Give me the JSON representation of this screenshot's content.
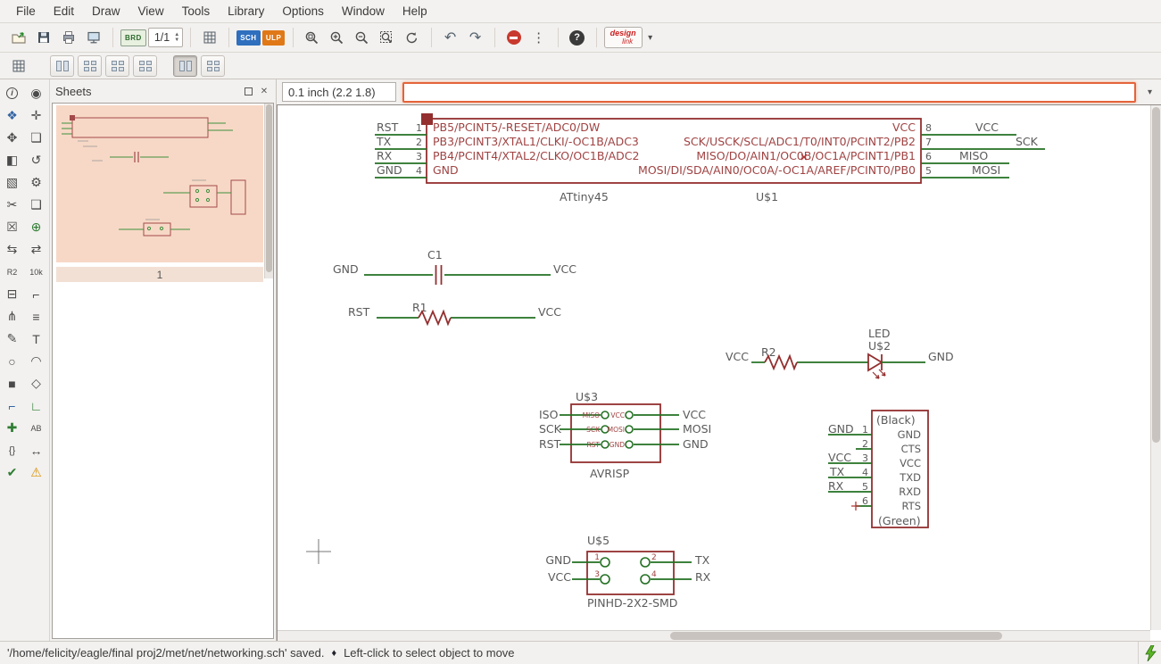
{
  "menubar": {
    "items": [
      "File",
      "Edit",
      "Draw",
      "View",
      "Tools",
      "Library",
      "Options",
      "Window",
      "Help"
    ]
  },
  "toolbar": {
    "sheet_indicator": "1/1",
    "brd_label": "BRD",
    "sch_label": "SCH",
    "ulp_label": "ULP",
    "help_label": "?",
    "design_link_label_1": "design",
    "design_link_label_2": "link",
    "dropdown_caret": "▾",
    "undo_glyph": "↶",
    "redo_glyph": "↷",
    "dots_glyph": "⋮"
  },
  "display_toolbar": {
    "presets": [
      {
        "name": "display-preset-1",
        "pattern": 2,
        "pressed": false,
        "gap": false
      },
      {
        "name": "display-preset-2",
        "pattern": 4,
        "pressed": false,
        "gap": false
      },
      {
        "name": "display-preset-3",
        "pattern": 4,
        "pressed": false,
        "gap": false
      },
      {
        "name": "display-preset-4",
        "pattern": 4,
        "pressed": false,
        "gap": false
      },
      {
        "name": "display-preset-5",
        "pattern": 2,
        "pressed": true,
        "gap": true
      },
      {
        "name": "display-preset-6",
        "pattern": 4,
        "pressed": false,
        "gap": false
      }
    ]
  },
  "command_bar": {
    "coordinates": "0.1 inch (2.2 1.8)",
    "command_value": ""
  },
  "sheets_panel": {
    "title": "Sheets",
    "sheet_label": "1",
    "close_glyph": "✕"
  },
  "left_toolbar": {
    "tools": [
      {
        "name": "info-button",
        "glyph": "i",
        "circle": true
      },
      {
        "name": "show-button",
        "glyph": "◉"
      },
      {
        "name": "display-button",
        "glyph": "❖",
        "color": "#3465a4"
      },
      {
        "name": "mark-button",
        "glyph": "✛"
      },
      {
        "name": "move-button",
        "glyph": "✥"
      },
      {
        "name": "copy-button",
        "glyph": "❏"
      },
      {
        "name": "mirror-button",
        "glyph": "◧"
      },
      {
        "name": "rotate-button",
        "glyph": "↺"
      },
      {
        "name": "group-button",
        "glyph": "▧"
      },
      {
        "name": "change-button",
        "glyph": "⚙"
      },
      {
        "name": "cut-button",
        "glyph": "✂"
      },
      {
        "name": "paste-button",
        "glyph": "❑"
      },
      {
        "name": "delete-button",
        "glyph": "☒"
      },
      {
        "name": "add-button",
        "glyph": "⊕",
        "color": "#2e7d32"
      },
      {
        "name": "pinswap-button",
        "glyph": "⇆"
      },
      {
        "name": "replace-button",
        "glyph": "⇄"
      },
      {
        "name": "name-button",
        "glyph": "R2",
        "size": 9
      },
      {
        "name": "value-button",
        "glyph": "10k",
        "size": 9
      },
      {
        "name": "smash-button",
        "glyph": "⊟"
      },
      {
        "name": "miter-button",
        "glyph": "⌐"
      },
      {
        "name": "split-button",
        "glyph": "⋔"
      },
      {
        "name": "invoke-button",
        "glyph": "≡"
      },
      {
        "name": "wire-button",
        "glyph": "✎"
      },
      {
        "name": "text-button",
        "glyph": "T"
      },
      {
        "name": "circle-button",
        "glyph": "○"
      },
      {
        "name": "arc-button",
        "glyph": "◠"
      },
      {
        "name": "rect-button",
        "glyph": "■"
      },
      {
        "name": "polygon-button",
        "glyph": "◇"
      },
      {
        "name": "bus-button",
        "glyph": "⌐",
        "color": "#3465a4"
      },
      {
        "name": "net-button",
        "glyph": "∟",
        "color": "#2e7d32"
      },
      {
        "name": "junction-button",
        "glyph": "✚",
        "color": "#2e7d32"
      },
      {
        "name": "label-button",
        "glyph": "AB",
        "size": 9
      },
      {
        "name": "attribute-button",
        "glyph": "{}",
        "size": 11
      },
      {
        "name": "dimension-button",
        "glyph": "↔"
      },
      {
        "name": "erc-button",
        "glyph": "✔",
        "color": "#2e7d32"
      },
      {
        "name": "errors-button",
        "glyph": "⚠",
        "color": "#d99000"
      }
    ]
  },
  "schematic": {
    "ic1": {
      "name": "ATtiny45",
      "designator": "U$1",
      "left_pins": [
        {
          "net": "RST",
          "number": "1",
          "label": "PB5/PCINT5/-RESET/ADC0/DW"
        },
        {
          "net": "TX",
          "number": "2",
          "label": "PB3/PCINT3/XTAL1/CLKI/-OC1B/ADC3"
        },
        {
          "net": "RX",
          "number": "3",
          "label": "PB4/PCINT4/XTAL2/CLKO/OC1B/ADC2"
        },
        {
          "net": "GND",
          "number": "4",
          "label": "GND"
        }
      ],
      "right_pins": [
        {
          "net": "VCC",
          "number": "8",
          "label": "VCC"
        },
        {
          "net": "SCK",
          "number": "7",
          "label": "SCK/USCK/SCL/ADC1/T0/INT0/PCINT2/PB2"
        },
        {
          "net": "MISO",
          "number": "6",
          "label": "MISO/DO/AIN1/OC0B/OC1A/PCINT1/PB1"
        },
        {
          "net": "MOSI",
          "number": "5",
          "label": "MOSI/DI/SDA/AIN0/OC0A/-OC1A/AREF/PCINT0/PB0"
        }
      ]
    },
    "c1": {
      "designator": "C1",
      "net_left": "GND",
      "net_right": "VCC"
    },
    "r1": {
      "designator": "R1",
      "net_left": "RST",
      "net_right": "VCC"
    },
    "r2": {
      "designator": "R2",
      "net_left": "VCC",
      "net_right": "GND",
      "led_label": "LED",
      "led_designator": "U$2"
    },
    "u3": {
      "designator": "U$3",
      "name": "AVRISP",
      "left_nets": [
        "ISO",
        "SCK",
        "RST"
      ],
      "right_nets": [
        "VCC",
        "MOSI",
        "GND"
      ],
      "pad_labels_left": [
        "MISO",
        "SCK",
        "RST"
      ],
      "pad_labels_right": [
        "VCC",
        "MOSI",
        "GND"
      ]
    },
    "ftdi": {
      "top_label": "(Black)",
      "bottom_label": "(Green)",
      "pins": [
        {
          "net": "GND",
          "number": "1",
          "label": "GND"
        },
        {
          "net": "",
          "number": "2",
          "label": "CTS"
        },
        {
          "net": "VCC",
          "number": "3",
          "label": "VCC"
        },
        {
          "net": "TX",
          "number": "4",
          "label": "TXD"
        },
        {
          "net": "RX",
          "number": "5",
          "label": "RXD"
        },
        {
          "net": "",
          "number": "6",
          "label": "RTS"
        }
      ]
    },
    "u5": {
      "designator": "U$5",
      "name": "PINHD-2X2-SMD",
      "left_nets": [
        "GND",
        "VCC"
      ],
      "right_nets": [
        "TX",
        "RX"
      ],
      "pad_numbers": [
        "1",
        "2",
        "3",
        "4"
      ]
    }
  },
  "statusbar": {
    "message": "'/home/felicity/eagle/final proj2/met/net/networking.sch' saved.",
    "separator": "♦",
    "hint": "Left-click to select object to move"
  }
}
